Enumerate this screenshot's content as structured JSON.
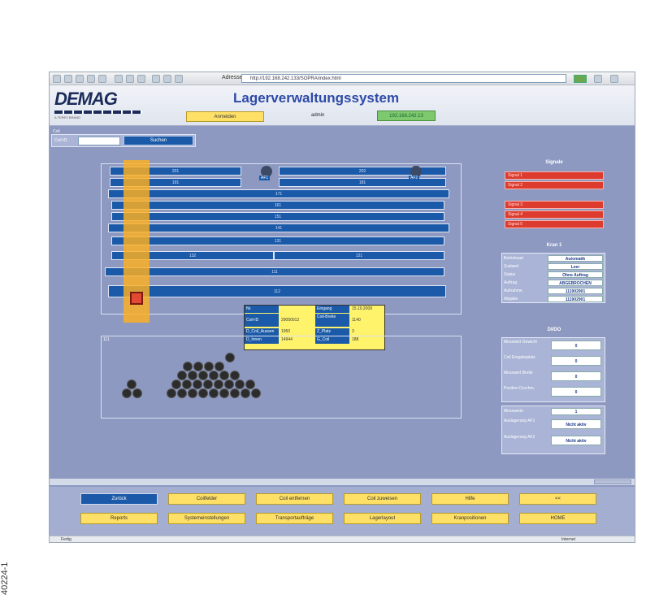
{
  "browser": {
    "address_label": "Adresse",
    "address_value": "http://192.168.242.133/SOPRA/index.html"
  },
  "header": {
    "logo_text": "DEMAG",
    "logo_subtext": "A TEREX BRAND",
    "title": "Lagerverwaltungssystem",
    "anmelden_label": "Anmelden",
    "user_label": "admin",
    "ip_address": "192.168.242.13"
  },
  "search": {
    "title": "Coil",
    "field_label": "Coil-ID:",
    "button_label": "Suchen"
  },
  "warehouse": {
    "lanes": [
      {
        "label": "201"
      },
      {
        "label": "202"
      },
      {
        "label": "191"
      },
      {
        "label": "181"
      },
      {
        "label": "171"
      },
      {
        "label": "161"
      },
      {
        "label": "151"
      },
      {
        "label": "141"
      },
      {
        "label": "131"
      },
      {
        "label": "132"
      },
      {
        "label": "121"
      },
      {
        "label": "111"
      },
      {
        "label": "112"
      }
    ],
    "stopper_labels": [
      "AF1",
      "AF2"
    ]
  },
  "tooltip": {
    "rows": [
      {
        "k1": "Nr.",
        "v1": "",
        "k2": "Eingang",
        "v2": "15.10.2009"
      },
      {
        "k1": "Coil-ID",
        "v1": "29050012",
        "k2": "Coil-Breite",
        "v2": "1140"
      },
      {
        "k1": "D_Coil_Aussen",
        "v1": "1950",
        "k2": "Z_Platz",
        "v2": "3"
      },
      {
        "k1": "D_Innen",
        "v1": "14944",
        "k2": "G_Coil",
        "v2": "188"
      }
    ]
  },
  "coil_area": {
    "label": "111"
  },
  "signals": {
    "title": "Signale",
    "bars": [
      "Signal 1",
      "Signal 2",
      "Signal 3",
      "Signal 4",
      "Signal 5"
    ]
  },
  "crane": {
    "title": "Kran 1",
    "rows": [
      {
        "key": "Betriebsart",
        "value": "Automatik"
      },
      {
        "key": "Zustand",
        "value": "Leer"
      },
      {
        "key": "Status",
        "value": "Ohne Auftrag"
      },
      {
        "key": "Auftrag",
        "value": "ABGEBROCHEN"
      },
      {
        "key": "Aufnahme",
        "value": "111902901"
      },
      {
        "key": "Abgabe",
        "value": "111902901"
      }
    ]
  },
  "io": {
    "title": "DI/DO",
    "rows": [
      {
        "key": "Messwert Gewicht",
        "value": "0"
      },
      {
        "key": "Coil Eingabeplatz",
        "value": "0"
      },
      {
        "key": "Messwert Breite",
        "value": "0"
      },
      {
        "key": "Position Durchm.",
        "value": "0"
      }
    ],
    "lower_rows": [
      {
        "key": "Messwerte",
        "value": "1"
      },
      {
        "key": "Auslagerung AF1",
        "value": "Nicht aktiv"
      },
      {
        "key": "Auslagerung AF2",
        "value": "Nicht aktiv"
      }
    ]
  },
  "bottom_nav": {
    "row1": [
      "Zurück",
      "Coilfelder",
      "Coil entfernen",
      "Coil zuweisen",
      "Hilfe",
      "<<"
    ],
    "row2": [
      "Reports",
      "Systemeinstellungen",
      "Transportaufträge",
      "Lagerlayout",
      "Kranpositionen",
      "HOME"
    ]
  },
  "status_bar": {
    "text": "Fertig",
    "zone": "Internet"
  },
  "image_id": "40224-1"
}
